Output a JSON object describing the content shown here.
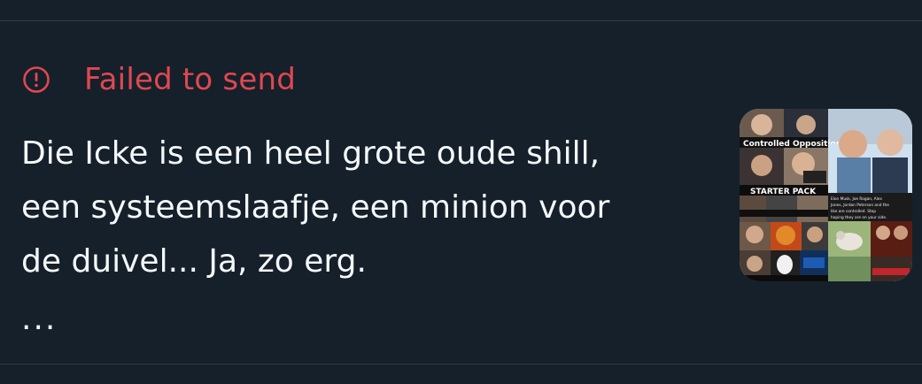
{
  "status": {
    "icon": "alert-circle-icon",
    "text": "Failed to send",
    "color": "#e0484f"
  },
  "tweet": {
    "text": "Die Icke is een heel grote oude shill,\neen systeemslaafje, een minion voor\nde duivel... Ja, zo erg.",
    "more": "..."
  },
  "thumbnail": {
    "title": "Controlled Opposition",
    "banner": "STARTER PACK",
    "caption_small": "Elon Musk, Joe Rogan, Alex Jones, Jordan Peterson and the like are controlled. Stop hoping they are on your side."
  },
  "colors": {
    "background": "#15202b",
    "divider": "#2f3b47",
    "text": "#f5f8fa",
    "error": "#e0484f"
  }
}
